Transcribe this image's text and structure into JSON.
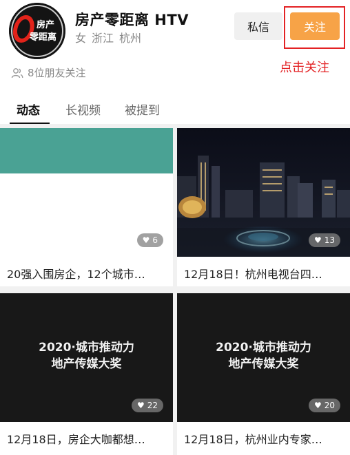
{
  "profile": {
    "avatar_text_top": "房产",
    "avatar_text_bottom": "零距离",
    "name": "房产零距离 HTV",
    "gender": "女",
    "province": "浙江",
    "city": "杭州",
    "friends_following": "8位朋友关注"
  },
  "actions": {
    "message_label": "私信",
    "follow_label": "关注",
    "annotation": "点击关注",
    "follow_color": "#f7a347",
    "annotation_color": "#e32224"
  },
  "tabs": [
    {
      "label": "动态",
      "active": true
    },
    {
      "label": "长视频",
      "active": false
    },
    {
      "label": "被提到",
      "active": false
    }
  ],
  "posts": [
    {
      "caption": "20强入围房企，12个城市…",
      "likes": "6",
      "thumb": "teal-banner"
    },
    {
      "caption": "12月18日！杭州电视台四…",
      "likes": "13",
      "thumb": "night-skyline"
    },
    {
      "caption": "12月18日，房企大咖都想…",
      "likes": "22",
      "thumb": "award-gala",
      "overlay_line1": "2020·城市推动力",
      "overlay_line2": "地产传媒大奖"
    },
    {
      "caption": "12月18日，杭州业内专家…",
      "likes": "20",
      "thumb": "award-gala",
      "overlay_line1": "2020·城市推动力",
      "overlay_line2": "地产传媒大奖"
    }
  ],
  "icons": {
    "friends": "people-icon",
    "like": "heart-icon"
  }
}
